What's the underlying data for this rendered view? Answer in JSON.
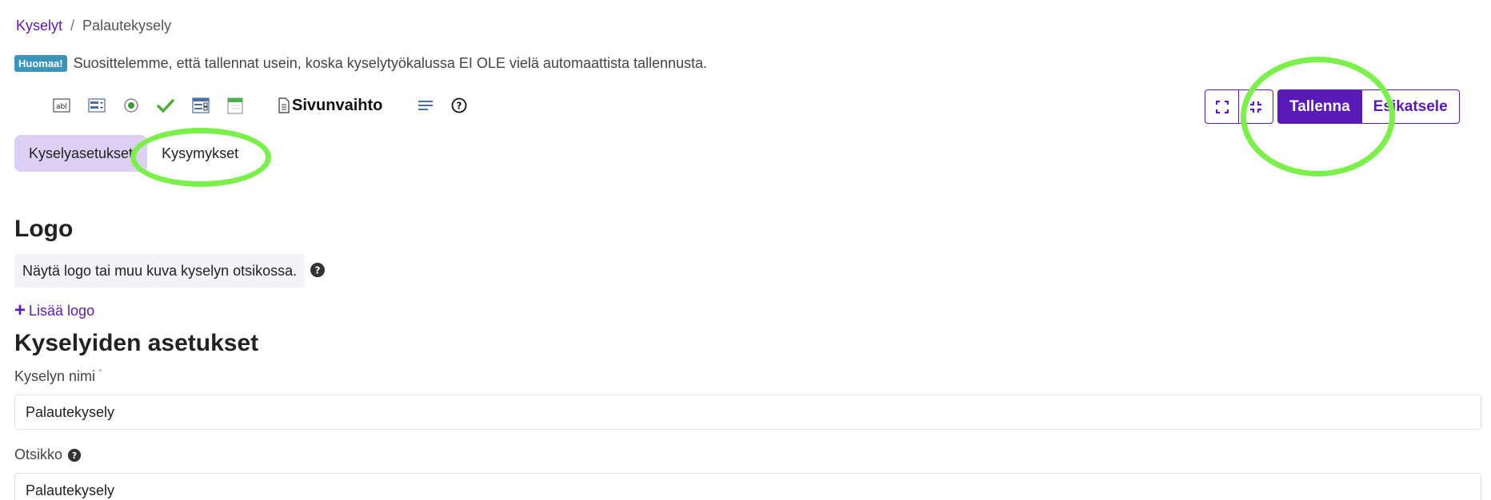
{
  "breadcrumb": {
    "items": [
      {
        "label": "Kyselyt",
        "link": true
      },
      {
        "label": "Palautekysely",
        "link": false
      }
    ],
    "separator": "/"
  },
  "notice": {
    "badge": "Huomaa!",
    "text": "Suosittelemme, että tallennat usein, koska kyselytyökalussa EI OLE vielä automaattista tallennusta."
  },
  "toolbar": {
    "icons": [
      "text-field-icon",
      "dropdown-select-icon",
      "radio-button-icon",
      "checkmark-icon",
      "matrix-grid-icon",
      "date-calendar-icon",
      "page-break-icon",
      "text-label-icon",
      "help-icon"
    ],
    "page_break_label": "Sivunvaihto"
  },
  "view_controls": {
    "expand_icon": "expand-icon",
    "collapse_icon": "collapse-icon",
    "save_label": "Tallenna",
    "preview_label": "Esikatsele"
  },
  "tabs": [
    {
      "label": "Kyselyasetukset",
      "active": true
    },
    {
      "label": "Kysymykset",
      "active": false
    }
  ],
  "logo_section": {
    "title": "Logo",
    "help_text": "Näytä logo tai muu kuva kyselyn otsikossa.",
    "add_label": "Lisää logo"
  },
  "settings_section": {
    "title": "Kyselyiden asetukset",
    "name_label": "Kyselyn nimi",
    "name_required": "*",
    "name_value": "Palautekysely",
    "heading_label": "Otsikko",
    "heading_value": "Palautekysely"
  },
  "colors": {
    "accent": "#5a1ab8",
    "active_tab": "#ddd0f5",
    "annotation": "#7bf04a",
    "badge": "#3a95b8"
  }
}
